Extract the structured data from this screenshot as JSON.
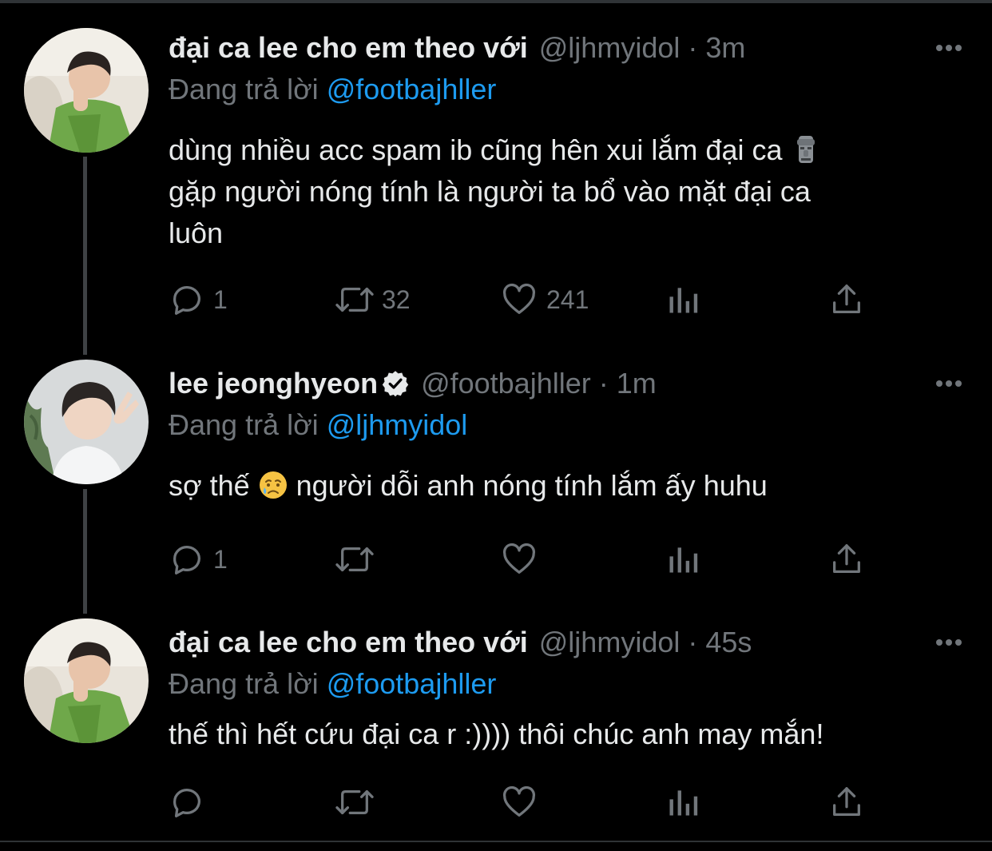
{
  "tweets": [
    {
      "display_name": "đại ca lee cho em theo với",
      "handle": "@ljhmyidol",
      "separator": "·",
      "time": "3m",
      "replying_prefix": "Đang trả lời ",
      "replying_to": "@footbajhller",
      "text_lines": [
        "dùng nhiều acc spam ib cũng hên xui lắm đại ca",
        "gặp người nóng tính là người ta bổ vào mặt đại ca",
        "luôn"
      ],
      "emoji": "moai-icon",
      "counts": {
        "reply": "1",
        "retweet": "32",
        "like": "241"
      }
    },
    {
      "display_name": "lee jeonghyeon",
      "verified": true,
      "handle": "@footbajhller",
      "separator": "·",
      "time": "1m",
      "replying_prefix": "Đang trả lời ",
      "replying_to": "@ljhmyidol",
      "text_before_emoji": "sợ thế ",
      "emoji": "sad-but-relieved-face-icon",
      "text_after_emoji": " người dỗi anh nóng tính lắm ấy huhu",
      "counts": {
        "reply": "1",
        "retweet": "",
        "like": ""
      }
    },
    {
      "display_name": "đại ca lee cho em theo với",
      "handle": "@ljhmyidol",
      "separator": "·",
      "time": "45s",
      "replying_prefix": "Đang trả lời ",
      "replying_to": "@footbajhller",
      "text": "thế thì hết cứu đại ca r :)))) thôi chúc anh may mắn!",
      "counts": {
        "reply": "",
        "retweet": "",
        "like": ""
      }
    }
  ],
  "colors": {
    "background": "#000000",
    "primary_text": "#e7e9ea",
    "secondary_text": "#71767b",
    "link": "#1d9bf0",
    "thread_line": "#3e4144"
  }
}
